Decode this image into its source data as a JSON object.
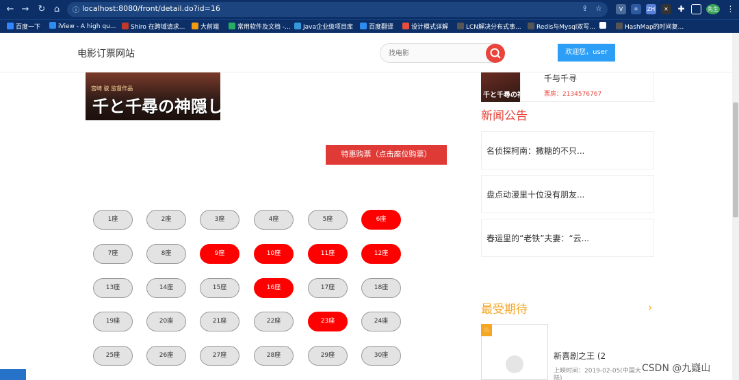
{
  "browser": {
    "url": "localhost:8080/front/detail.do?id=16",
    "bookmarks": [
      {
        "label": "百度一下",
        "color": "#3385ff"
      },
      {
        "label": "iView - A high qu...",
        "color": "#2d8cf0"
      },
      {
        "label": "Shiro 在跨域请求...",
        "color": "#c0392b"
      },
      {
        "label": "大前端",
        "color": "#f39c12"
      },
      {
        "label": "常用软件及文档 -...",
        "color": "#27ae60"
      },
      {
        "label": "Java企业级项目库",
        "color": "#3498db"
      },
      {
        "label": "百度翻译",
        "color": "#2d8cf0"
      },
      {
        "label": "设计模式详解",
        "color": "#e74c3c"
      },
      {
        "label": "LCN解决分布式事...",
        "color": "#555555"
      },
      {
        "label": "Redis与Mysql双写...",
        "color": "#555555"
      },
      {
        "label": "",
        "color": "#ffffff"
      },
      {
        "label": "HashMap的时间复...",
        "color": "#555555"
      }
    ],
    "extension_badge": "先生",
    "ext_zh_label": "ZH"
  },
  "header": {
    "logo": "电影订票网站",
    "search_placeholder": "找电影",
    "welcome": "欢迎您，user"
  },
  "movie": {
    "poster_tag": "宫崎 骏 监督作品",
    "poster_title": "千と千尋の神隠し",
    "buy_button": "特惠购票（点击座位购票）"
  },
  "seats": [
    {
      "label": "1座",
      "sold": false
    },
    {
      "label": "2座",
      "sold": false
    },
    {
      "label": "3座",
      "sold": false
    },
    {
      "label": "4座",
      "sold": false
    },
    {
      "label": "5座",
      "sold": false
    },
    {
      "label": "6座",
      "sold": true
    },
    {
      "label": "7座",
      "sold": false
    },
    {
      "label": "8座",
      "sold": false
    },
    {
      "label": "9座",
      "sold": true
    },
    {
      "label": "10座",
      "sold": true
    },
    {
      "label": "11座",
      "sold": true
    },
    {
      "label": "12座",
      "sold": true
    },
    {
      "label": "13座",
      "sold": false
    },
    {
      "label": "14座",
      "sold": false
    },
    {
      "label": "15座",
      "sold": false
    },
    {
      "label": "16座",
      "sold": true
    },
    {
      "label": "17座",
      "sold": false
    },
    {
      "label": "18座",
      "sold": false
    },
    {
      "label": "19座",
      "sold": false
    },
    {
      "label": "20座",
      "sold": false
    },
    {
      "label": "21座",
      "sold": false
    },
    {
      "label": "22座",
      "sold": false
    },
    {
      "label": "23座",
      "sold": true
    },
    {
      "label": "24座",
      "sold": false
    },
    {
      "label": "25座",
      "sold": false
    },
    {
      "label": "26座",
      "sold": false
    },
    {
      "label": "27座",
      "sold": false
    },
    {
      "label": "28座",
      "sold": false
    },
    {
      "label": "29座",
      "sold": false
    },
    {
      "label": "30座",
      "sold": false
    }
  ],
  "sidebar": {
    "current_movie": {
      "thumb_text": "千と千尋の神隠し",
      "title": "千与千寻",
      "box_office": "票房：2134576767"
    },
    "news_title": "新闻公告",
    "news": [
      "名侦探柯南：撒糖的不只...",
      "盘点动漫里十位没有朋友...",
      "春运里的“老铁”夫妻：“云..."
    ],
    "expected_title": "最受期待",
    "expected_arrow": "›",
    "expected_movie": {
      "name": "新喜剧之王 (2",
      "release": "上映时间：2019-02-05(中国大",
      "release_cont": "陆)"
    }
  },
  "watermark": "CSDN @九嶷山"
}
